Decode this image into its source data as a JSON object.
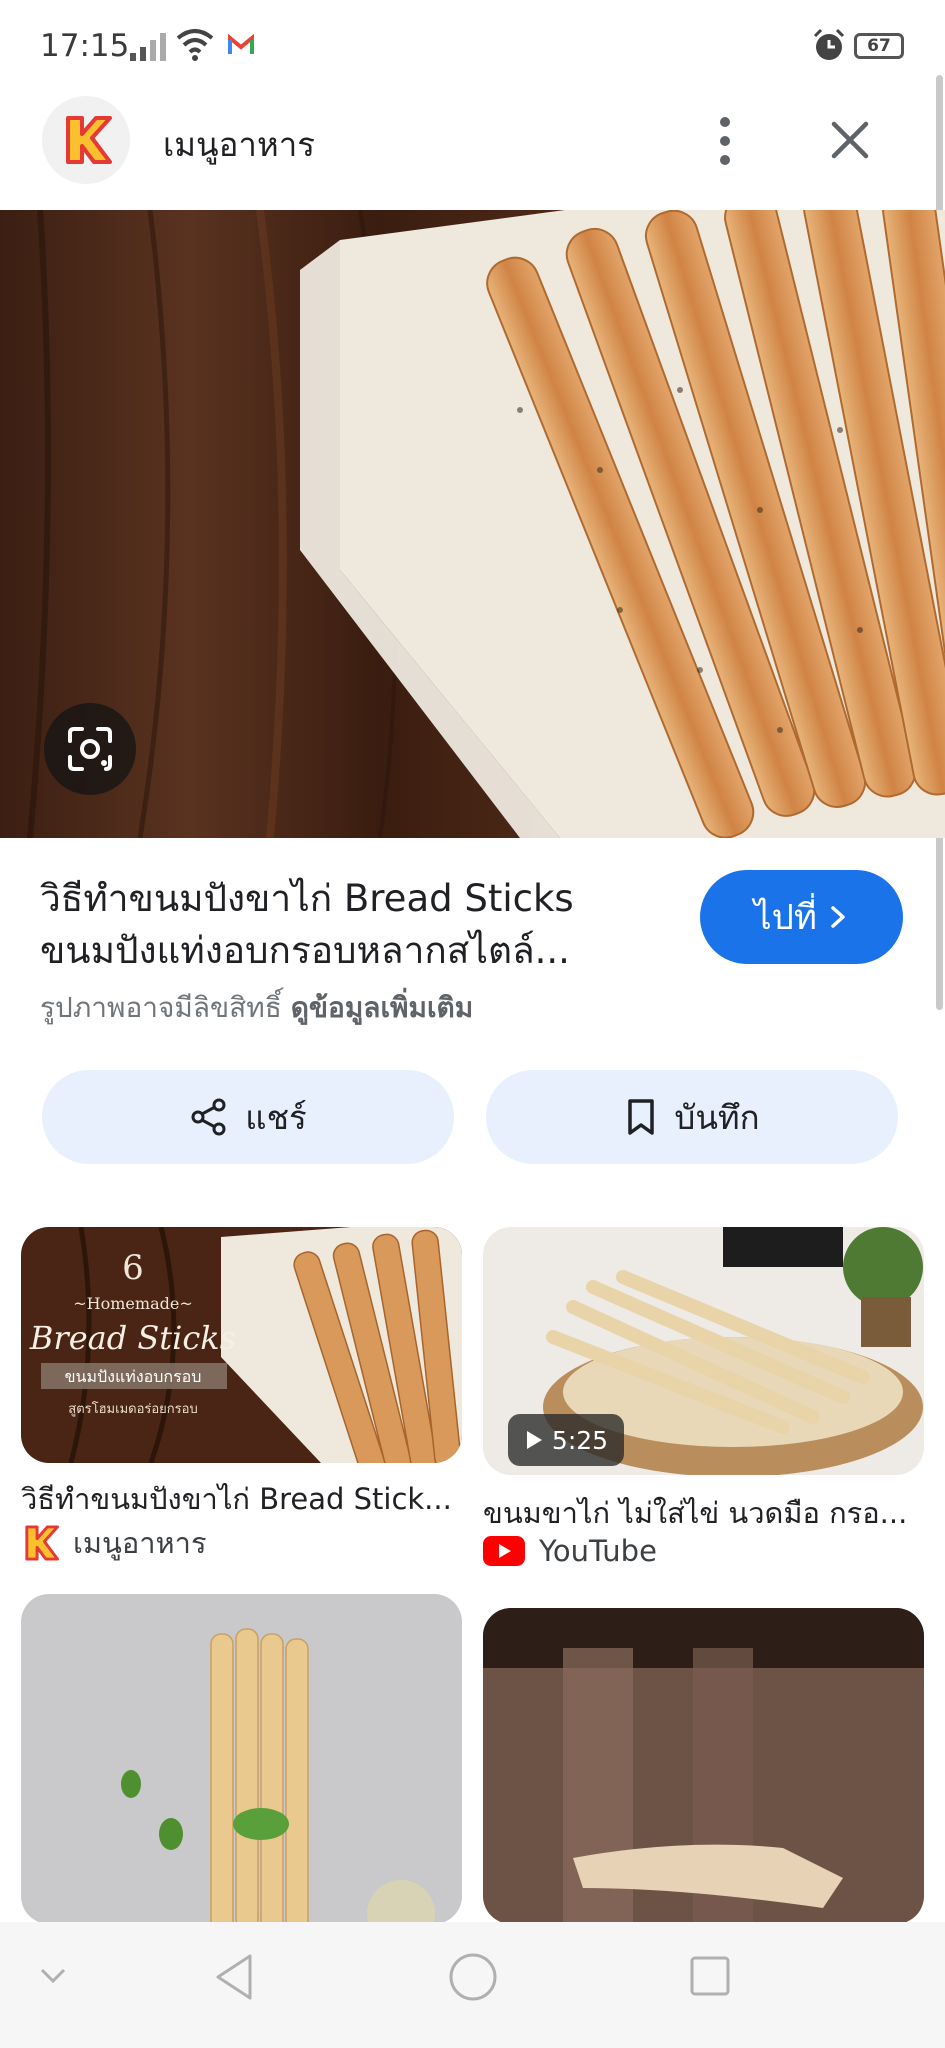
{
  "status_bar": {
    "time": "17:15",
    "battery": "67"
  },
  "header": {
    "title": "เมนูอาหาร"
  },
  "result": {
    "title_line1": "วิธีทำขนมปังขาไก่ Bread Sticks",
    "title_line2": "ขนมปังแท่งอบกรอบหลากสไตล์...",
    "copyright": "รูปภาพอาจมีลิขสิทธิ์",
    "more_info": "ดูข้อมูลเพิ่มเติม",
    "visit_label": "ไปที่"
  },
  "actions": {
    "share_label": "แชร์",
    "save_label": "บันทึก"
  },
  "grid": [
    {
      "caption": "วิธีทำขนมปังขาไก่ Bread Stick...",
      "source": "เมนูอาหาร",
      "overlay": {
        "number": "6",
        "homemade": "~Homemade~",
        "title": "Bread Sticks",
        "thai": "ขนมปังแท่งอบกรอบ",
        "sub": "สูตรโฮมเมดอร่อยกรอบ"
      }
    },
    {
      "caption": "ขนมขาไก่ ไม่ใส่ไข่ นวดมือ กรอ...",
      "source": "YouTube",
      "duration": "5:25"
    }
  ],
  "colors": {
    "accent": "#1a73e8",
    "pill_bg": "#e8f0fe",
    "youtube_red": "#ff0000",
    "logo_red": "#e53935",
    "logo_yellow": "#fbc02d"
  }
}
